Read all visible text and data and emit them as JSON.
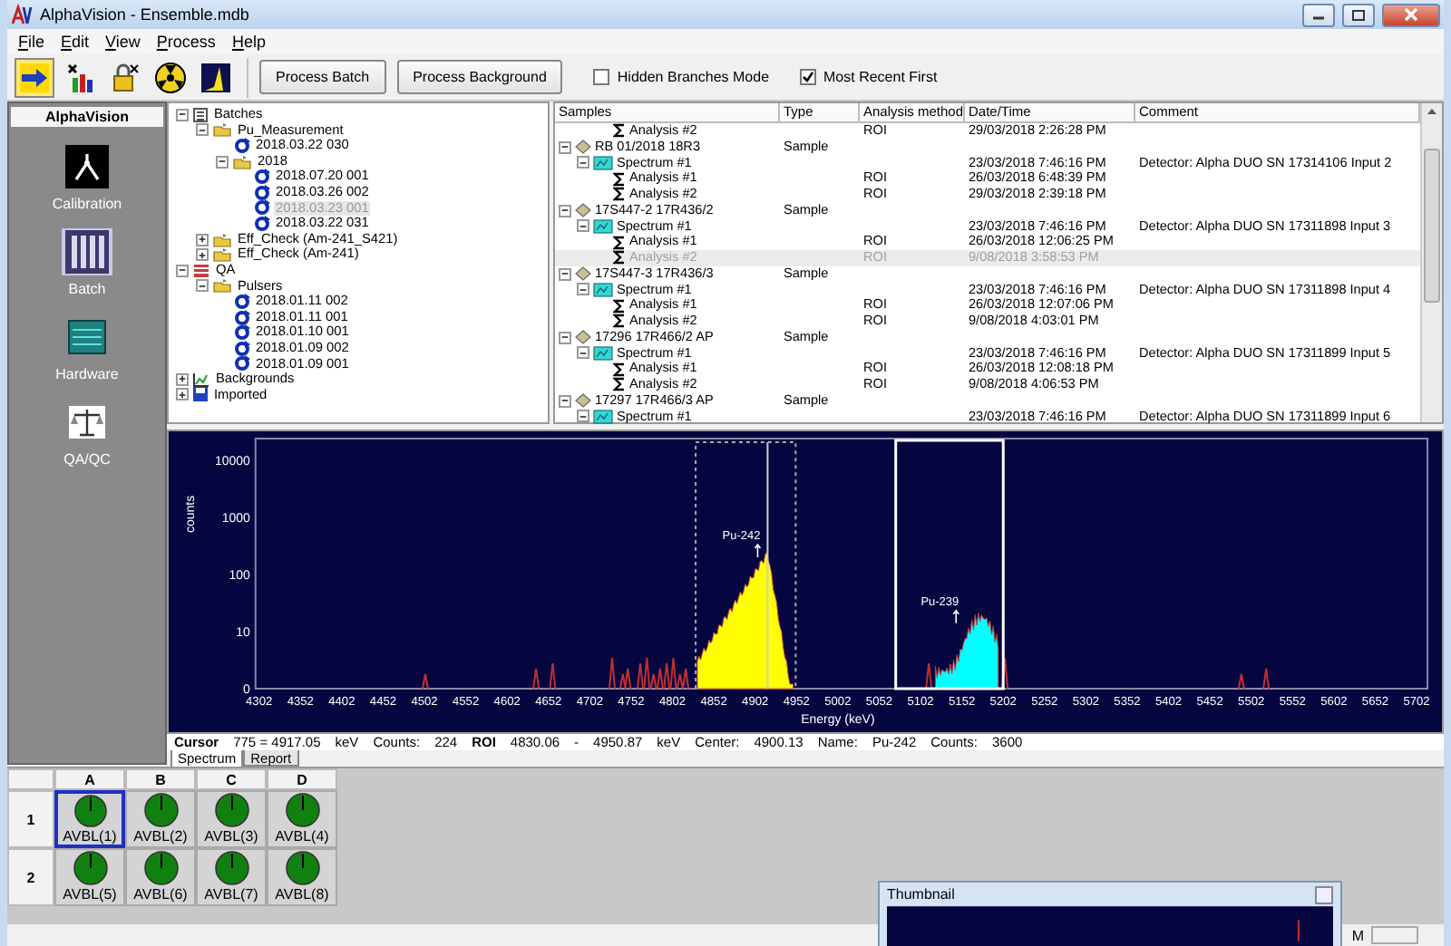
{
  "window": {
    "title": "AlphaVision - Ensemble.mdb"
  },
  "menu": [
    "File",
    "Edit",
    "View",
    "Process",
    "Help"
  ],
  "toolbar": {
    "buttons": [
      "Process Batch",
      "Process Background"
    ],
    "checkboxes": [
      {
        "label": "Hidden Branches Mode",
        "checked": false
      },
      {
        "label": "Most Recent First",
        "checked": true
      }
    ]
  },
  "sidebar": {
    "title": "AlphaVision",
    "items": [
      {
        "label": "Calibration",
        "kind": "calibration",
        "selected": false
      },
      {
        "label": "Batch",
        "kind": "batch",
        "selected": true
      },
      {
        "label": "Hardware",
        "kind": "hardware",
        "selected": false
      },
      {
        "label": "QA/QC",
        "kind": "qaqc",
        "selected": false
      }
    ]
  },
  "batch_tree": [
    {
      "label": "Batches",
      "kind": "batches",
      "expanded": true,
      "selected": false,
      "children": [
        {
          "label": "Pu_Measurement",
          "kind": "group",
          "expanded": true,
          "selected": false,
          "children": [
            {
              "label": "2018.03.22 030",
              "kind": "batch",
              "selected": false
            },
            {
              "label": "2018",
              "kind": "group",
              "expanded": true,
              "selected": false,
              "children": [
                {
                  "label": "2018.07.20 001",
                  "kind": "batch",
                  "selected": false
                },
                {
                  "label": "2018.03.26 002",
                  "kind": "batch",
                  "selected": false
                },
                {
                  "label": "2018.03.23 001",
                  "kind": "batch",
                  "selected": true
                },
                {
                  "label": "2018.03.22 031",
                  "kind": "batch",
                  "selected": false
                }
              ]
            }
          ]
        },
        {
          "label": "Eff_Check (Am-241_S421)",
          "kind": "group",
          "expanded": false,
          "selected": false
        },
        {
          "label": "Eff_Check (Am-241)",
          "kind": "group",
          "expanded": false,
          "selected": false
        }
      ]
    },
    {
      "label": "QA",
      "kind": "qa",
      "expanded": true,
      "selected": false,
      "children": [
        {
          "label": "Pulsers",
          "kind": "group",
          "expanded": true,
          "selected": false,
          "children": [
            {
              "label": "2018.01.11 002",
              "kind": "batch",
              "selected": false
            },
            {
              "label": "2018.01.11 001",
              "kind": "batch",
              "selected": false
            },
            {
              "label": "2018.01.10 001",
              "kind": "batch",
              "selected": false
            },
            {
              "label": "2018.01.09 002",
              "kind": "batch",
              "selected": false
            },
            {
              "label": "2018.01.09 001",
              "kind": "batch",
              "selected": false
            }
          ]
        }
      ]
    },
    {
      "label": "Backgrounds",
      "kind": "backgrounds",
      "expanded": false,
      "selected": false
    },
    {
      "label": "Imported",
      "kind": "imported",
      "expanded": false,
      "selected": false
    }
  ],
  "samples": {
    "columns": [
      "Samples",
      "Type",
      "Analysis method",
      "Date/Time",
      "Comment"
    ],
    "rows": [
      {
        "children": [
          {
            "children": [
              {
                "name": "Analysis #2",
                "kind": "analysis",
                "method": "ROI",
                "datetime": "29/03/2018 2:26:28 PM",
                "selected": false
              }
            ]
          }
        ]
      },
      {
        "name": "RB 01/2018  18R3",
        "kind": "sample",
        "type": "Sample",
        "expanded": true,
        "selected": false,
        "children": [
          {
            "name": "Spectrum #1",
            "kind": "spectrum",
            "datetime": "23/03/2018 7:46:16 PM",
            "comment": "Detector: Alpha DUO SN 17314106 Input 2",
            "expanded": true,
            "selected": false,
            "children": [
              {
                "name": "Analysis #1",
                "kind": "analysis",
                "method": "ROI",
                "datetime": "26/03/2018 6:48:39 PM",
                "selected": false
              },
              {
                "name": "Analysis #2",
                "kind": "analysis",
                "method": "ROI",
                "datetime": "29/03/2018 2:39:18 PM",
                "selected": false
              }
            ]
          }
        ]
      },
      {
        "name": "17S447-2  17R436/2",
        "kind": "sample",
        "type": "Sample",
        "expanded": true,
        "selected": false,
        "children": [
          {
            "name": "Spectrum #1",
            "kind": "spectrum",
            "datetime": "23/03/2018 7:46:16 PM",
            "comment": "Detector: Alpha DUO SN 17311898 Input 3",
            "expanded": true,
            "selected": false,
            "children": [
              {
                "name": "Analysis #1",
                "kind": "analysis",
                "method": "ROI",
                "datetime": "26/03/2018 12:06:25 PM",
                "selected": false
              },
              {
                "name": "Analysis #2",
                "kind": "analysis",
                "method": "ROI",
                "datetime": "9/08/2018 3:58:53 PM",
                "selected": true
              }
            ]
          }
        ]
      },
      {
        "name": "17S447-3  17R436/3",
        "kind": "sample",
        "type": "Sample",
        "expanded": true,
        "selected": false,
        "children": [
          {
            "name": "Spectrum #1",
            "kind": "spectrum",
            "datetime": "23/03/2018 7:46:16 PM",
            "comment": "Detector: Alpha DUO SN 17311898 Input 4",
            "expanded": true,
            "selected": false,
            "children": [
              {
                "name": "Analysis #1",
                "kind": "analysis",
                "method": "ROI",
                "datetime": "26/03/2018 12:07:06 PM",
                "selected": false
              },
              {
                "name": "Analysis #2",
                "kind": "analysis",
                "method": "ROI",
                "datetime": "9/08/2018 4:03:01 PM",
                "selected": false
              }
            ]
          }
        ]
      },
      {
        "name": "17296  17R466/2  AP",
        "kind": "sample",
        "type": "Sample",
        "expanded": true,
        "selected": false,
        "children": [
          {
            "name": "Spectrum #1",
            "kind": "spectrum",
            "datetime": "23/03/2018 7:46:16 PM",
            "comment": "Detector: Alpha DUO SN 17311899 Input 5",
            "expanded": true,
            "selected": false,
            "children": [
              {
                "name": "Analysis #1",
                "kind": "analysis",
                "method": "ROI",
                "datetime": "26/03/2018 12:08:18 PM",
                "selected": false
              },
              {
                "name": "Analysis #2",
                "kind": "analysis",
                "method": "ROI",
                "datetime": "9/08/2018 4:06:53 PM",
                "selected": false
              }
            ]
          }
        ]
      },
      {
        "name": "17297  17R466/3  AP",
        "kind": "sample",
        "type": "Sample",
        "expanded": true,
        "selected": false,
        "children": [
          {
            "name": "Spectrum #1",
            "kind": "spectrum",
            "datetime": "23/03/2018 7:46:16 PM",
            "comment": "Detector: Alpha DUO SN 17311899 Input 6",
            "expanded": true,
            "selected": false
          }
        ]
      }
    ]
  },
  "spectrum": {
    "ylabel": "counts",
    "xlabel": "Energy (keV)",
    "yticks": [
      "10000",
      "1000",
      "100",
      "10",
      "0"
    ],
    "xticks": [
      "4302",
      "4352",
      "4402",
      "4452",
      "4502",
      "4552",
      "4602",
      "4652",
      "4702",
      "4752",
      "4802",
      "4852",
      "4902",
      "4952",
      "5002",
      "5052",
      "5102",
      "5152",
      "5202",
      "5252",
      "5302",
      "5352",
      "5402",
      "5452",
      "5502",
      "5552",
      "5602",
      "5652",
      "5702"
    ],
    "peaks": [
      {
        "label": "Pu-242"
      },
      {
        "label": "Pu-239"
      }
    ]
  },
  "cursor_info": [
    {
      "text": "Cursor",
      "bold": true
    },
    {
      "text": "775 = 4917.05",
      "bold": false
    },
    {
      "text": "keV",
      "bold": false
    },
    {
      "text": "Counts:",
      "bold": false
    },
    {
      "text": "224",
      "bold": false
    },
    {
      "text": "ROI",
      "bold": true
    },
    {
      "text": "4830.06",
      "bold": false
    },
    {
      "text": "-",
      "bold": false
    },
    {
      "text": "4950.87",
      "bold": false
    },
    {
      "text": "keV",
      "bold": false
    },
    {
      "text": "Center:",
      "bold": false
    },
    {
      "text": "4900.13",
      "bold": false
    },
    {
      "text": "Name:",
      "bold": false
    },
    {
      "text": "Pu-242",
      "bold": false
    },
    {
      "text": "Counts:",
      "bold": false
    },
    {
      "text": "3600",
      "bold": false
    }
  ],
  "view_tabs": [
    {
      "label": "Spectrum",
      "selected": true
    },
    {
      "label": "Report",
      "selected": false
    }
  ],
  "detectors": {
    "columns": [
      "A",
      "B",
      "C",
      "D"
    ],
    "rows": [
      {
        "label": "1",
        "cells": [
          {
            "label": "AVBL(1)",
            "selected": true
          },
          {
            "label": "AVBL(2)",
            "selected": false
          },
          {
            "label": "AVBL(3)",
            "selected": false
          },
          {
            "label": "AVBL(4)",
            "selected": false
          }
        ]
      },
      {
        "label": "2",
        "cells": [
          {
            "label": "AVBL(5)",
            "selected": false
          },
          {
            "label": "AVBL(6)",
            "selected": false
          },
          {
            "label": "AVBL(7)",
            "selected": false
          },
          {
            "label": "AVBL(8)",
            "selected": false
          }
        ]
      }
    ]
  },
  "thumbnail": {
    "title": "Thumbnail"
  },
  "status_bar": {
    "text": "M"
  }
}
